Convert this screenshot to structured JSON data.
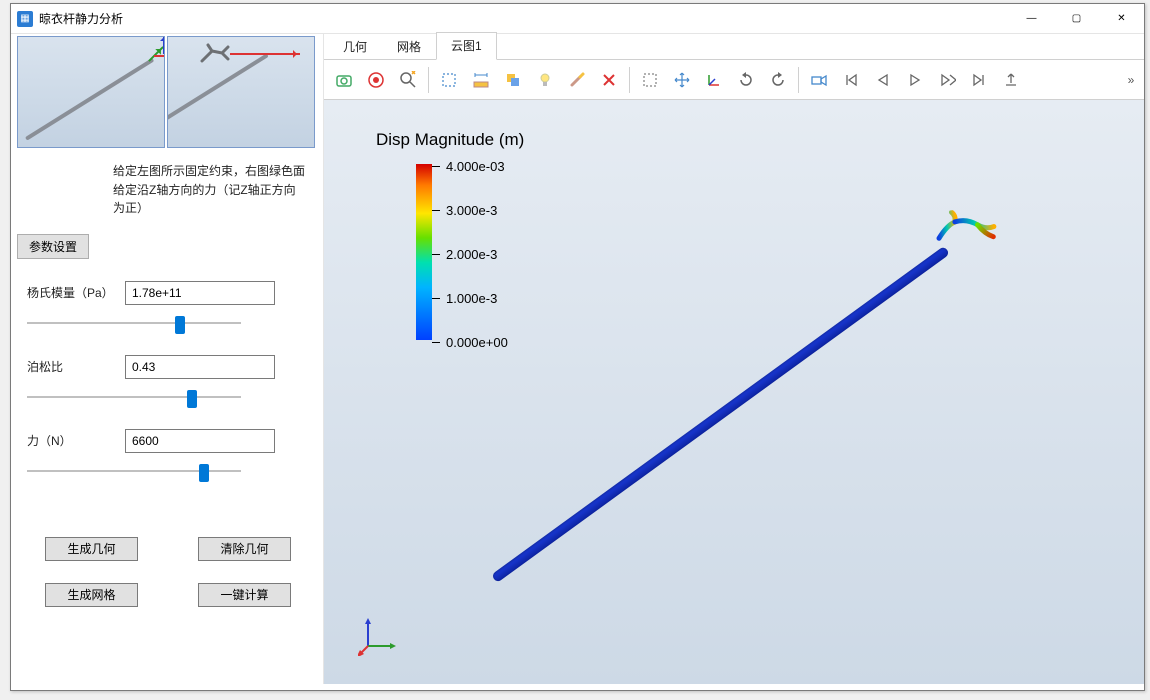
{
  "window": {
    "title": "晾衣杆静力分析",
    "controls": {
      "min": "—",
      "max": "▢",
      "close": "✕"
    }
  },
  "help_text": "给定左图所示固定约束，右图绿色面给定沿Z轴方向的力（记Z轴正方向为正）",
  "section_button": "参数设置",
  "params": {
    "young": {
      "label": "杨氏模量（Pa）",
      "value": "1.78e+11"
    },
    "poisson": {
      "label": "泊松比",
      "value": "0.43"
    },
    "force": {
      "label": "力（N）",
      "value": "6600"
    }
  },
  "actions": {
    "gen_geom": "生成几何",
    "clear_geom": "清除几何",
    "gen_mesh": "生成网格",
    "one_click": "一键计算"
  },
  "tabs": {
    "geom": "几何",
    "mesh": "网格",
    "contour": "云图1"
  },
  "toolbar": {
    "camera": "camera-icon",
    "video": "circle-play-icon",
    "zoomfit": "zoom-fit-icon",
    "select": "selection-icon",
    "ruler": "ruler-icon",
    "layers": "stack-icon",
    "light": "lightbulb-icon",
    "brush": "brush-icon",
    "clear": "x-clear-icon",
    "marquee": "marquee-icon",
    "move": "pan-icon",
    "axes": "axes-icon",
    "rotcw": "rotate-cw-icon",
    "rotccw": "rotate-ccw-icon",
    "cam2": "camcorder-icon",
    "first": "skip-first-icon",
    "prev": "play-prev-icon",
    "play": "play-icon",
    "next": "play-next-icon",
    "last": "skip-last-icon",
    "export": "export-icon",
    "more": "»"
  },
  "legend": {
    "title": "Disp Magnitude (m)",
    "ticks": [
      "4.000e-03",
      "3.000e-3",
      "2.000e-3",
      "1.000e-3",
      "0.000e+00"
    ]
  },
  "chart_data": {
    "type": "contour-scale",
    "quantity": "Displacement Magnitude",
    "unit": "m",
    "min": 0.0,
    "max": 0.004,
    "ticks": [
      0.004,
      0.003,
      0.002,
      0.001,
      0.0
    ],
    "colormap": "rainbow"
  }
}
